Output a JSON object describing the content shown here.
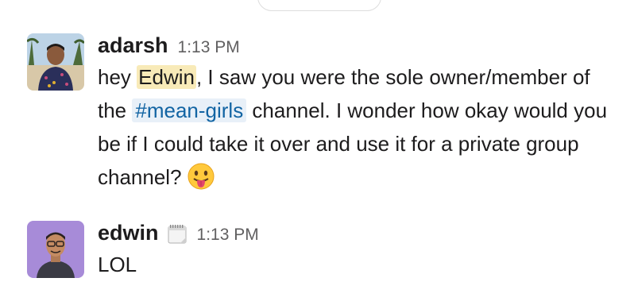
{
  "messages": [
    {
      "author": "adarsh",
      "time": "1:13 PM",
      "text_1": "hey ",
      "mention": "Edwin",
      "text_2": ", I saw you were the sole owner/member of the ",
      "channel": "#mean-girls",
      "text_3": " channel. I wonder how okay would you be if I could take it over and use it for a private group channel?",
      "emoji": "stuck-out-tongue-emoji"
    },
    {
      "author": "edwin",
      "status_icon": "calendar-icon",
      "time": "1:13 PM",
      "text": "LOL"
    }
  ],
  "colors": {
    "mention_bg": "#f8eab8",
    "channel_text": "#1264a3",
    "channel_bg": "#e8f0f8",
    "timestamp": "#616061"
  }
}
